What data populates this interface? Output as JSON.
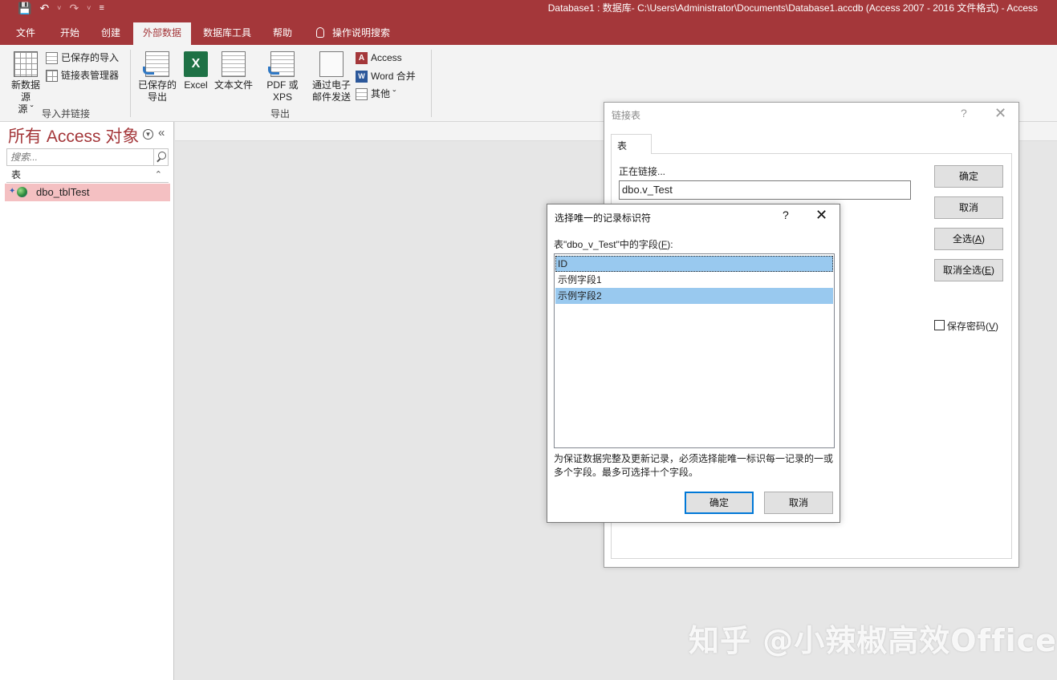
{
  "window": {
    "title": "Database1 : 数据库- C:\\Users\\Administrator\\Documents\\Database1.accdb (Access 2007 - 2016 文件格式)  -  Access"
  },
  "ribbon": {
    "tabs": [
      {
        "label": "文件",
        "active": false
      },
      {
        "label": "开始",
        "active": false
      },
      {
        "label": "创建",
        "active": false
      },
      {
        "label": "外部数据",
        "active": true
      },
      {
        "label": "数据库工具",
        "active": false
      },
      {
        "label": "帮助",
        "active": false
      }
    ],
    "tell_me": "操作说明搜索",
    "import_group": {
      "label": "导入并链接",
      "new_data_source": "新数据源",
      "new_data_source_2": "源 ˇ",
      "saved_imports": "已保存的导入",
      "linked_table_manager": "链接表管理器"
    },
    "export_group": {
      "label": "导出",
      "saved_exports_1": "已保存的",
      "saved_exports_2": "导出",
      "excel": "Excel",
      "text_file": "文本文件",
      "pdf_xps": "PDF 或 XPS",
      "email_1": "通过电子",
      "email_2": "邮件发送",
      "access": "Access",
      "word_merge": "Word 合并",
      "more": "其他 ˇ"
    }
  },
  "nav": {
    "title": "所有 Access 对象",
    "search_placeholder": "搜索...",
    "group": "表",
    "items": [
      {
        "label": "dbo_tblTest"
      }
    ]
  },
  "link_dialog": {
    "title": "链接表",
    "help": "?",
    "tab": "表",
    "linking_label": "正在链接...",
    "linking_value": "dbo.v_Test",
    "ok": "确定",
    "cancel": "取消",
    "select_all": "全选(",
    "select_all_key": "A",
    "deselect_all": "取消全选(",
    "deselect_all_key": "E",
    "save_password": "保存密码(",
    "save_password_key": "V",
    "close_paren": ")"
  },
  "uid_dialog": {
    "title": "选择唯一的记录标识符",
    "help": "?",
    "fields_label": "表\"dbo_v_Test\"中的字段(",
    "fields_key": "F",
    "fields_end": "):",
    "fields": [
      {
        "label": "ID",
        "selected": true
      },
      {
        "label": "示例字段1",
        "selected": false
      },
      {
        "label": "示例字段2",
        "selected": true
      }
    ],
    "note": "为保证数据完整及更新记录，必须选择能唯一标识每一记录的一或多个字段。最多可选择十个字段。",
    "ok": "确定",
    "cancel": "取消"
  },
  "watermark": "知乎 @小辣椒高效Office"
}
